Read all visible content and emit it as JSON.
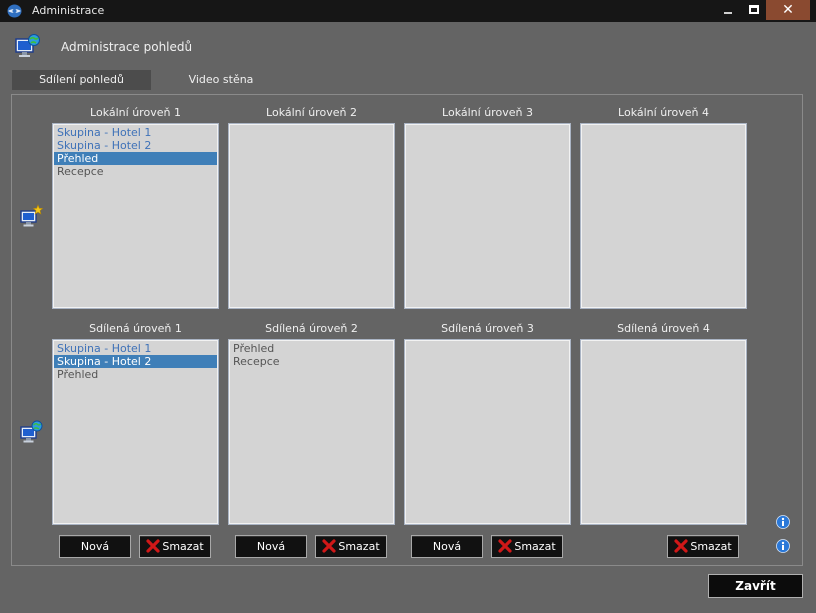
{
  "window": {
    "title": "Administrace",
    "close_glyph": "✕"
  },
  "header": {
    "title": "Administrace pohledů",
    "icon": "monitor-globe-icon"
  },
  "tabs": [
    {
      "label": "Sdílení pohledů",
      "active": true
    },
    {
      "label": "Video stěna",
      "active": false
    }
  ],
  "local_levels": [
    {
      "label": "Lokální úroveň 1",
      "items": [
        {
          "text": "Skupina - Hotel 1",
          "kind": "group",
          "selected": false
        },
        {
          "text": "Skupina - Hotel 2",
          "kind": "group",
          "selected": false
        },
        {
          "text": "Přehled",
          "kind": "item",
          "selected": true
        },
        {
          "text": "Recepce",
          "kind": "item",
          "selected": false
        }
      ]
    },
    {
      "label": "Lokální úroveň 2",
      "items": []
    },
    {
      "label": "Lokální úroveň 3",
      "items": []
    },
    {
      "label": "Lokální úroveň 4",
      "items": []
    }
  ],
  "shared_levels": [
    {
      "label": "Sdílená úroveň 1",
      "items": [
        {
          "text": "Skupina - Hotel 1",
          "kind": "group",
          "selected": false
        },
        {
          "text": "Skupina - Hotel 2",
          "kind": "group",
          "selected": true
        },
        {
          "text": "Přehled",
          "kind": "item",
          "selected": false
        }
      ]
    },
    {
      "label": "Sdílená úroveň 2",
      "items": [
        {
          "text": "Přehled",
          "kind": "item",
          "selected": false
        },
        {
          "text": "Recepce",
          "kind": "item",
          "selected": false
        }
      ]
    },
    {
      "label": "Sdílená úroveň 3",
      "items": []
    },
    {
      "label": "Sdílená úroveň 4",
      "items": []
    }
  ],
  "buttons": {
    "new_label": "Nová",
    "delete_label": "Smazat",
    "close_label": "Zavřít"
  },
  "colors": {
    "selection": "#3f7fb8",
    "group_text": "#3f72b8",
    "delete_red": "#d01818",
    "info_blue": "#2a78d8"
  }
}
